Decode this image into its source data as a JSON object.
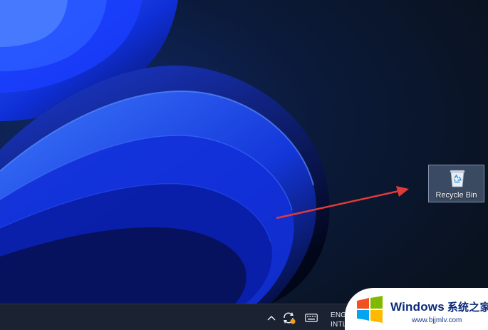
{
  "desktop": {
    "icons": [
      {
        "label": "Recycle Bin",
        "icon": "recycle-bin-icon"
      }
    ]
  },
  "taskbar": {
    "tray": {
      "icons": [
        "chevron-up-icon",
        "sync-status-icon",
        "touch-keyboard-icon"
      ],
      "language_line1": "ENG",
      "language_line2": "INTL"
    }
  },
  "watermark": {
    "brand": "Windows",
    "brand_cn": "系统之家",
    "url": "www.bjjmlv.com"
  },
  "colors": {
    "wallpaper_base": "#0a1526",
    "wallpaper_accent": "#1a3cff",
    "arrow": "#e03a3a",
    "taskbar": "#1b2332",
    "selection": "#7c8ca8"
  }
}
